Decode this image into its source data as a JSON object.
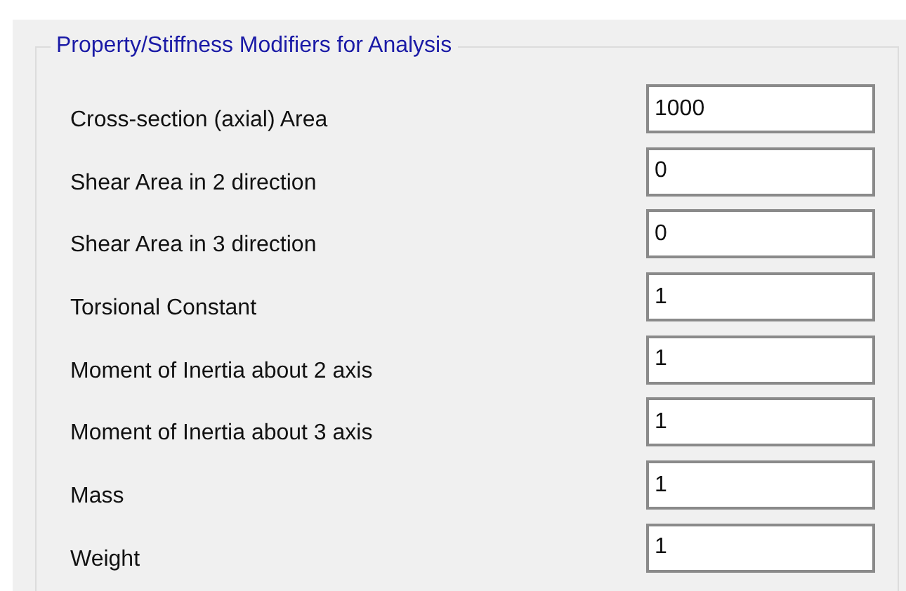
{
  "group": {
    "title": "Property/Stiffness Modifiers for Analysis"
  },
  "modifiers": [
    {
      "label": "Cross-section (axial) Area",
      "value": "1000"
    },
    {
      "label": "Shear Area in 2 direction",
      "value": "0"
    },
    {
      "label": "Shear Area in 3 direction",
      "value": "0"
    },
    {
      "label": "Torsional Constant",
      "value": "1"
    },
    {
      "label": "Moment of Inertia about 2 axis",
      "value": "1"
    },
    {
      "label": "Moment of Inertia about 3 axis",
      "value": "1"
    },
    {
      "label": "Mass",
      "value": "1"
    },
    {
      "label": "Weight",
      "value": "1"
    }
  ]
}
